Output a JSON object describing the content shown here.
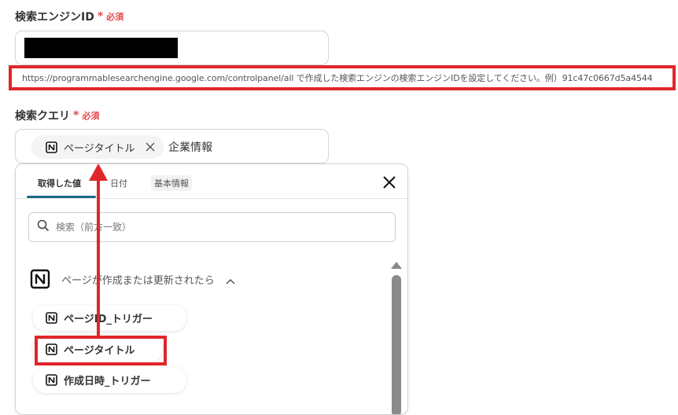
{
  "engine_id_field": {
    "label": "検索エンジンID",
    "required_star": "*",
    "required_text": "必須"
  },
  "hint": {
    "text": "https://programmablesearchengine.google.com/controlpanel/all で作成した検索エンジンの検索エンジンIDを設定してください。例）91c47c0667d5a4544"
  },
  "query_field": {
    "label": "検索クエリ",
    "required_star": "*",
    "required_text": "必須",
    "chip_label": "ページタイトル",
    "trailing_text": "企業情報"
  },
  "panel": {
    "tabs": [
      {
        "label": "取得した値"
      },
      {
        "label": "日付"
      },
      {
        "label": "基本情報"
      }
    ],
    "search_placeholder": "検索（前方一致）",
    "group_title": "ページが作成または更新されたら",
    "items": [
      {
        "label": "ページID_トリガー"
      },
      {
        "label": "ページタイトル"
      },
      {
        "label": "作成日時_トリガー"
      }
    ]
  },
  "colors": {
    "accent_red": "#e0262a",
    "required_red": "#e5484d",
    "tab_underline": "#1b6d86"
  },
  "icons": {
    "app": "notion-icon",
    "remove": "close-icon",
    "close_panel": "close-icon",
    "search": "search-icon",
    "collapse": "chevron-up-icon"
  }
}
